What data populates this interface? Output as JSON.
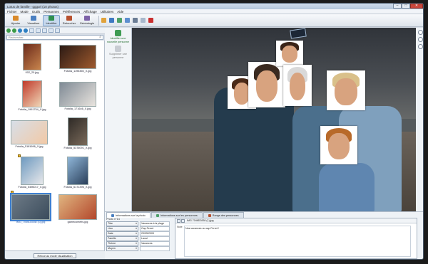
{
  "window": {
    "title": "Lotus de famille - gggurl (10 photos)"
  },
  "menu": [
    "Fichier",
    "Mode",
    "Outils",
    "Personnes",
    "Préférences",
    "Affichage",
    "Utilitaires",
    "Aide"
  ],
  "toolbar": {
    "buttons": [
      {
        "label": "Ajouter",
        "color": "#d98a2b"
      },
      {
        "label": "Visualiser",
        "color": "#4a7fc1"
      },
      {
        "label": "Identifier",
        "color": "#2f8f4e"
      },
      {
        "label": "Retoucher",
        "color": "#b8512f"
      },
      {
        "label": "Généalogie",
        "color": "#7d63a8"
      }
    ],
    "small_icons": [
      "#e0a23a",
      "#3e79c2",
      "#4ea06a",
      "#5c8fcf",
      "#6b7d95",
      "#a8b8cc",
      "#c92f2f"
    ]
  },
  "search": {
    "placeholder": "Rechercher"
  },
  "thumbnails": [
    {
      "caption": "002_20.jpg",
      "colors": [
        "#6a2a1b",
        "#c9854d"
      ]
    },
    {
      "caption": "Fotolia_1195355_X.jpg",
      "colors": [
        "#2b1a14",
        "#a05a2e"
      ]
    },
    {
      "caption": "Fotolia_1991754_X.jpg",
      "colors": [
        "#c03a2b",
        "#f0d8b8"
      ]
    },
    {
      "caption": "Fotolia_171646_X.jpg",
      "colors": [
        "#7f8a95",
        "#e9e4de"
      ]
    },
    {
      "caption": "Fotolia_5181696_X.jpg",
      "colors": [
        "#d7dfe8",
        "#f2c9a6"
      ]
    },
    {
      "caption": "Fotolia_5376091_X.jpg",
      "colors": [
        "#2e2a26",
        "#7a6a5a"
      ]
    },
    {
      "caption": "Fotolia_5496017_X.jpg",
      "colors": [
        "#6e9ac0",
        "#e8e8ea"
      ]
    },
    {
      "caption": "Fotolia_6171396_X.jpg",
      "colors": [
        "#8fb6d8",
        "#2a3f5a"
      ]
    },
    {
      "caption": "IMG_7046D2838 (1).jpg",
      "colors": [
        "#6d7a86",
        "#3b4c5c"
      ],
      "selected": true
    },
    {
      "caption": "gamecomelts.jpg",
      "colors": [
        "#e0b47f",
        "#b3472c"
      ]
    }
  ],
  "left_footer": {
    "button_label": "Retour au mode visualisation"
  },
  "side_tools": [
    {
      "label": "Identifier une nouvelle personne",
      "state": "on",
      "color": "#3d9b52"
    },
    {
      "label": "Supprimer une personne",
      "state": "off",
      "color": "#c8ccd2"
    }
  ],
  "faces": [
    {
      "name": "woman-left",
      "hair": "#4a2a18"
    },
    {
      "name": "main-man",
      "hair": "#3a2a20"
    },
    {
      "name": "top-girl",
      "hair": "#3a2418"
    },
    {
      "name": "older-man",
      "hair": "#d9d9d9"
    },
    {
      "name": "older-woman",
      "hair": "#d9c08a"
    },
    {
      "name": "child",
      "hair": "#b86a2a"
    }
  ],
  "bottom_tabs": [
    {
      "label": "Informations sur la photo",
      "color": "#4a7fc1",
      "active": true
    },
    {
      "label": "Informations sur les personnes",
      "color": "#4ea06a",
      "active": false
    },
    {
      "label": "Rangs des personnes",
      "color": "#b8512f",
      "active": false
    }
  ],
  "info": {
    "header": "Photo n°14",
    "rows": [
      {
        "key": "Titre",
        "value": "Vacances à la plage"
      },
      {
        "key": "Lieu",
        "value": "Cap Ferret"
      },
      {
        "key": "Date",
        "value": "29/05/2009"
      },
      {
        "key": "Famille",
        "value": "Laval"
      },
      {
        "key": "Thème",
        "value": "Vacances"
      },
      {
        "key": "Moyen",
        "value": ""
      }
    ]
  },
  "note": {
    "toolbar_text": "IMG 7046D2838 (1).jpg",
    "label": "Note",
    "text": "Nos vacances au cap Ferret !"
  }
}
